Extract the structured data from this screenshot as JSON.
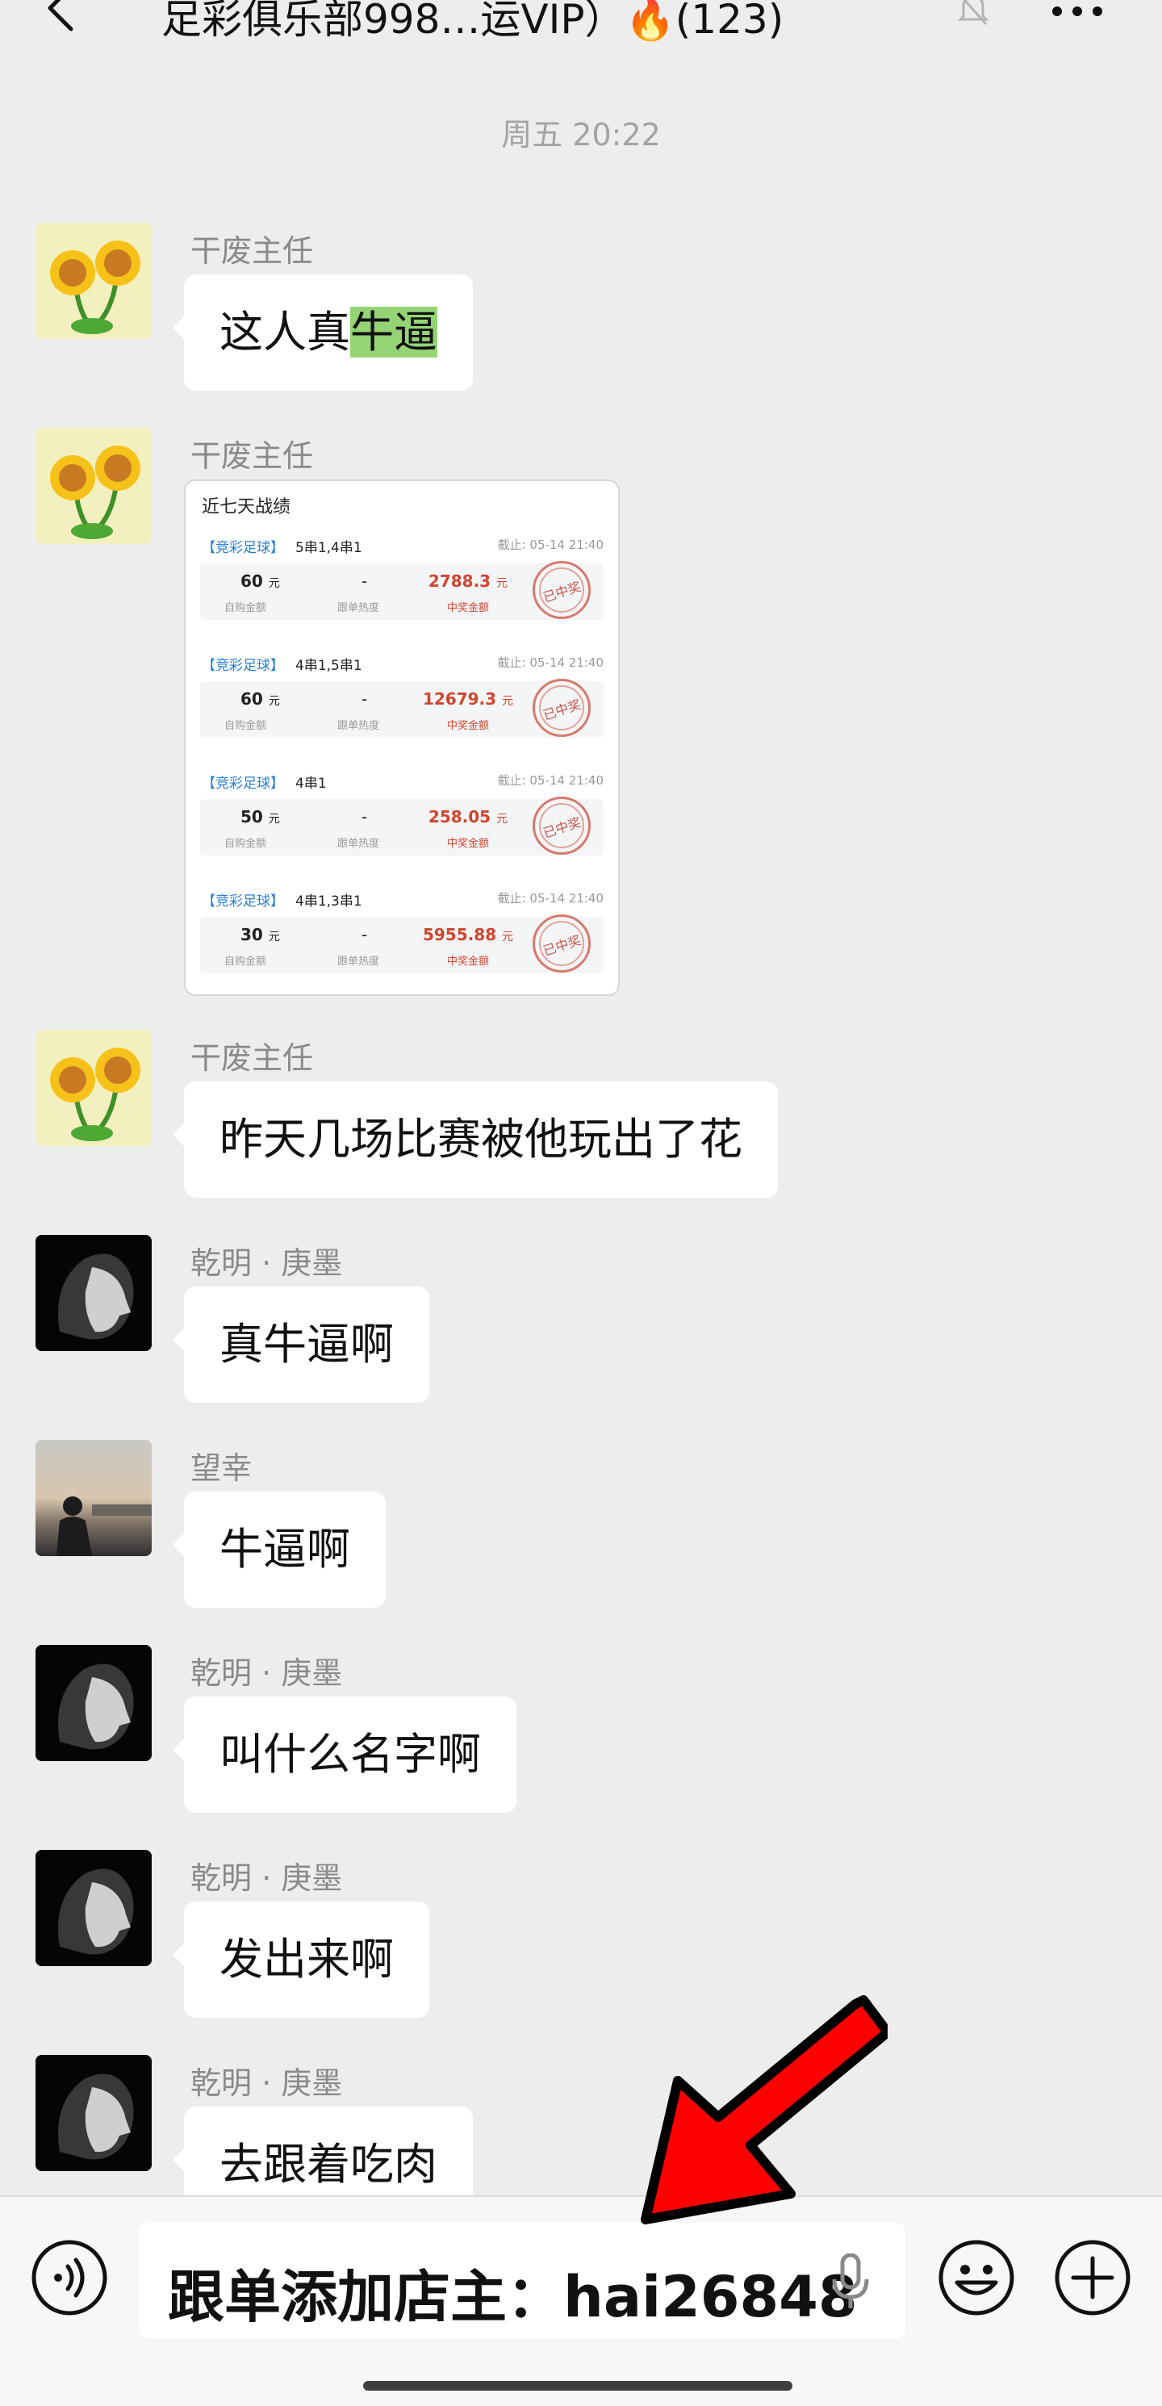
{
  "header": {
    "title": "足彩俱乐部998…运VIP）🔥(123)"
  },
  "timestamp": "周五 20:22",
  "messages": [
    {
      "sender": "干废主任",
      "text": "这人真",
      "highlight": "牛逼"
    },
    {
      "sender": "干废主任"
    },
    {
      "sender": "干废主任",
      "text": "昨天几场比赛被他玩出了花"
    },
    {
      "sender": "乾明 · 庚墨",
      "text": "真牛逼啊"
    },
    {
      "sender": "望幸",
      "text": "牛逼啊"
    },
    {
      "sender": "乾明 · 庚墨",
      "text": "叫什么名字啊"
    },
    {
      "sender": "乾明 · 庚墨",
      "text": "发出来啊"
    },
    {
      "sender": "乾明 · 庚墨",
      "text": "去跟着吃肉"
    }
  ],
  "record_card": {
    "title": "近七天战绩",
    "amount_label": "自购金额",
    "heat_label": "跟单热度",
    "prize_label": "中奖金额",
    "unit": "元",
    "stamp": "已中奖",
    "records": [
      {
        "tag": "【竞彩足球】",
        "type": "5串1,4串1",
        "deadline": "截止: 05-14 21:40",
        "amount": "60",
        "heat": "-",
        "prize": "2788.3"
      },
      {
        "tag": "【竞彩足球】",
        "type": "4串1,5串1",
        "deadline": "截止: 05-14 21:40",
        "amount": "60",
        "heat": "-",
        "prize": "12679.3"
      },
      {
        "tag": "【竞彩足球】",
        "type": "4串1",
        "deadline": "截止: 05-14 21:40",
        "amount": "50",
        "heat": "-",
        "prize": "258.05"
      },
      {
        "tag": "【竞彩足球】",
        "type": "4串1,3串1",
        "deadline": "截止: 05-14 21:40",
        "amount": "30",
        "heat": "-",
        "prize": "5955.88"
      }
    ]
  },
  "input": {
    "value": "跟单添加店主：hai26848"
  },
  "colors": {
    "background": "#ededed",
    "bubble": "#ffffff",
    "highlight": "#95d475",
    "arrow": "#ff0000"
  }
}
